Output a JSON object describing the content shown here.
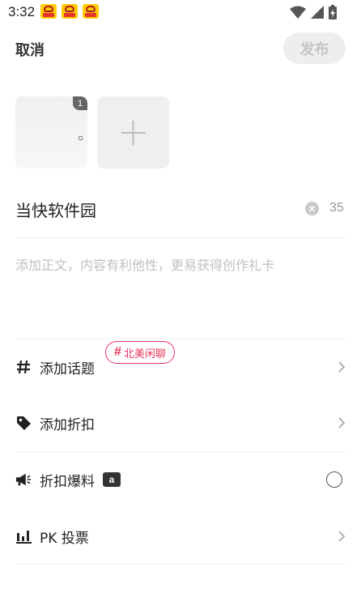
{
  "status_bar": {
    "time": "3:32",
    "notification_icons": [
      "app-notification-icon",
      "app-notification-icon",
      "app-notification-icon"
    ],
    "system_icons": [
      "wifi-icon",
      "signal-icon",
      "battery-charging-icon"
    ]
  },
  "header": {
    "cancel_label": "取消",
    "publish_label": "发布"
  },
  "images": {
    "count_badge": "1"
  },
  "title": {
    "value": "当快软件园",
    "remaining_chars": "35"
  },
  "body": {
    "placeholder": "添加正文，内容有利他性，更易获得创作礼卡"
  },
  "options": {
    "topic_label": "添加话题",
    "topic_suggestion": "北美闲聊",
    "discount_label": "添加折扣",
    "deal_label": "折扣爆料",
    "deal_badge": "a",
    "vote_label": "PK 投票"
  },
  "colors": {
    "accent": "#e7375d",
    "publish_disabled_bg": "#eeeeee",
    "publish_disabled_text": "#c4c4c4"
  }
}
